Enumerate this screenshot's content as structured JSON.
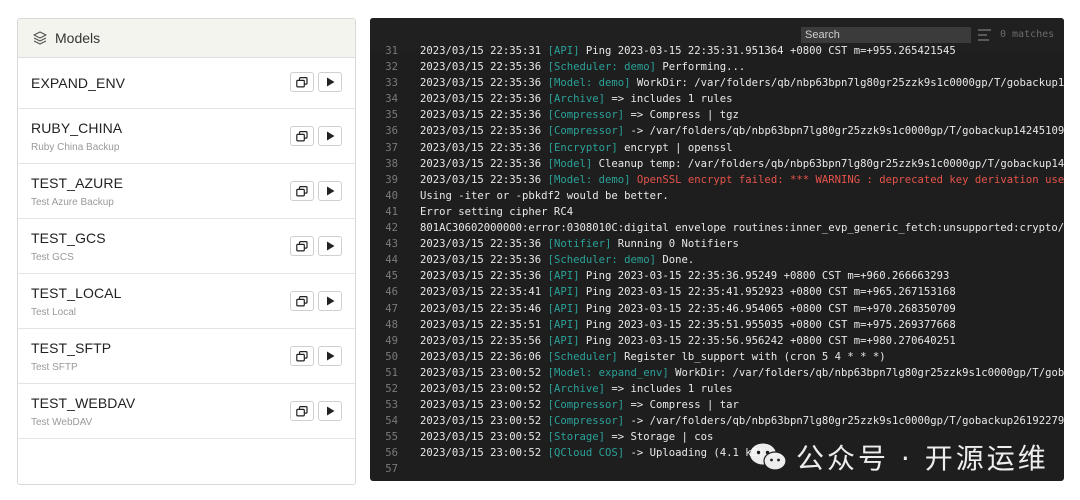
{
  "models_panel": {
    "title": "Models",
    "models": [
      {
        "name": "EXPAND_ENV",
        "description": ""
      },
      {
        "name": "RUBY_CHINA",
        "description": "Ruby China Backup"
      },
      {
        "name": "TEST_AZURE",
        "description": "Test Azure Backup"
      },
      {
        "name": "TEST_GCS",
        "description": "Test GCS"
      },
      {
        "name": "TEST_LOCAL",
        "description": "Test Local"
      },
      {
        "name": "TEST_SFTP",
        "description": "Test SFTP"
      },
      {
        "name": "TEST_WEBDAV",
        "description": "Test WebDAV"
      }
    ],
    "icons": {
      "header": "layers-icon",
      "copy": "copy-icon",
      "run": "play-icon"
    }
  },
  "log_panel": {
    "search": {
      "placeholder": "Search",
      "value": ""
    },
    "matches": "0 matches",
    "colors": {
      "background": "#1e1e1e",
      "tag": "#2aa198",
      "error": "#e5534b",
      "line_number": "#7a7a7a"
    },
    "lines": [
      {
        "n": "31",
        "ts": "2023/03/15 22:35:31",
        "tag": "[API]",
        "text": " Ping 2023-03-15 22:35:31.951364 +0800 CST m=+955.265421545",
        "error": ""
      },
      {
        "n": "32",
        "ts": "2023/03/15 22:35:36",
        "tag": "[Scheduler: demo]",
        "text": " Performing...",
        "error": ""
      },
      {
        "n": "33",
        "ts": "2023/03/15 22:35:36",
        "tag": "[Model: demo]",
        "text": " WorkDir: /var/folders/qb/nbp63bpn7lg80gr25zzk9s1c0000gp/T/gobackup14",
        "error": ""
      },
      {
        "n": "34",
        "ts": "2023/03/15 22:35:36",
        "tag": "[Archive]",
        "text": " => includes 1 rules",
        "error": ""
      },
      {
        "n": "35",
        "ts": "2023/03/15 22:35:36",
        "tag": "[Compressor]",
        "text": " => Compress | tgz",
        "error": ""
      },
      {
        "n": "36",
        "ts": "2023/03/15 22:35:36",
        "tag": "[Compressor]",
        "text": " -> /var/folders/qb/nbp63bpn7lg80gr25zzk9s1c0000gp/T/gobackup14245109",
        "error": ""
      },
      {
        "n": "37",
        "ts": "2023/03/15 22:35:36",
        "tag": "[Encryptor]",
        "text": " encrypt | openssl",
        "error": ""
      },
      {
        "n": "38",
        "ts": "2023/03/15 22:35:36",
        "tag": "[Model]",
        "text": " Cleanup temp: /var/folders/qb/nbp63bpn7lg80gr25zzk9s1c0000gp/T/gobackup142",
        "error": ""
      },
      {
        "n": "39",
        "ts": "2023/03/15 22:35:36",
        "tag": "[Model: demo]",
        "text": "",
        "error": " OpenSSL encrypt failed: *** WARNING : deprecated key derivation used"
      },
      {
        "n": "40",
        "ts": "",
        "tag": "",
        "text": "Using -iter or -pbkdf2 would be better.",
        "error": ""
      },
      {
        "n": "41",
        "ts": "",
        "tag": "",
        "text": "Error setting cipher RC4",
        "error": ""
      },
      {
        "n": "42",
        "ts": "",
        "tag": "",
        "text": "801AC30602000000:error:0308010C:digital envelope routines:inner_evp_generic_fetch:unsupported:crypto/e",
        "error": ""
      },
      {
        "n": "43",
        "ts": "2023/03/15 22:35:36",
        "tag": "[Notifier]",
        "text": " Running 0 Notifiers",
        "error": ""
      },
      {
        "n": "44",
        "ts": "2023/03/15 22:35:36",
        "tag": "[Scheduler: demo]",
        "text": " Done.",
        "error": ""
      },
      {
        "n": "45",
        "ts": "2023/03/15 22:35:36",
        "tag": "[API]",
        "text": " Ping 2023-03-15 22:35:36.95249 +0800 CST m=+960.266663293",
        "error": ""
      },
      {
        "n": "46",
        "ts": "2023/03/15 22:35:41",
        "tag": "[API]",
        "text": " Ping 2023-03-15 22:35:41.952923 +0800 CST m=+965.267153168",
        "error": ""
      },
      {
        "n": "47",
        "ts": "2023/03/15 22:35:46",
        "tag": "[API]",
        "text": " Ping 2023-03-15 22:35:46.954065 +0800 CST m=+970.268350709",
        "error": ""
      },
      {
        "n": "48",
        "ts": "2023/03/15 22:35:51",
        "tag": "[API]",
        "text": " Ping 2023-03-15 22:35:51.955035 +0800 CST m=+975.269377668",
        "error": ""
      },
      {
        "n": "49",
        "ts": "2023/03/15 22:35:56",
        "tag": "[API]",
        "text": " Ping 2023-03-15 22:35:56.956242 +0800 CST m=+980.270640251",
        "error": ""
      },
      {
        "n": "50",
        "ts": "2023/03/15 22:36:06",
        "tag": "[Scheduler]",
        "text": " Register lb_support with (cron 5 4 * * *)",
        "error": ""
      },
      {
        "n": "51",
        "ts": "2023/03/15 23:00:52",
        "tag": "[Model: expand_env]",
        "text": " WorkDir: /var/folders/qb/nbp63bpn7lg80gr25zzk9s1c0000gp/T/gobo",
        "error": ""
      },
      {
        "n": "52",
        "ts": "2023/03/15 23:00:52",
        "tag": "[Archive]",
        "text": " => includes 1 rules",
        "error": ""
      },
      {
        "n": "53",
        "ts": "2023/03/15 23:00:52",
        "tag": "[Compressor]",
        "text": " => Compress | tar",
        "error": ""
      },
      {
        "n": "54",
        "ts": "2023/03/15 23:00:52",
        "tag": "[Compressor]",
        "text": " -> /var/folders/qb/nbp63bpn7lg80gr25zzk9s1c0000gp/T/gobackup2619227921",
        "error": ""
      },
      {
        "n": "55",
        "ts": "2023/03/15 23:00:52",
        "tag": "[Storage]",
        "text": " => Storage | cos",
        "error": ""
      },
      {
        "n": "56",
        "ts": "2023/03/15 23:00:52",
        "tag": "[QCloud COS]",
        "text": " -> Uploading (4.1 kB)...",
        "error": ""
      },
      {
        "n": "57",
        "ts": "",
        "tag": "",
        "text": "",
        "error": ""
      }
    ]
  },
  "watermark": {
    "text": "公众号 · 开源运维",
    "icon": "wechat-icon"
  }
}
